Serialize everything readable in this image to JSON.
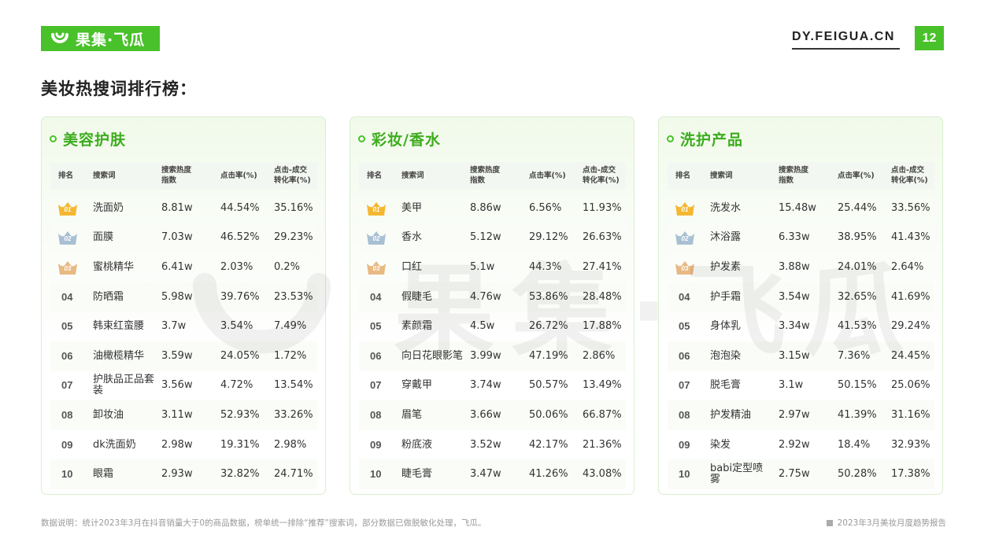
{
  "header": {
    "logo_text": "果集·飞瓜",
    "site": "DY.FEIGUA.CN",
    "page_number": "12",
    "brand_color": "#49c12a"
  },
  "title": "美妆热搜词排行榜：",
  "watermark": "果集·飞瓜",
  "columns": {
    "rank": "排名",
    "keyword": "搜索词",
    "heat_1": "搜索热度",
    "heat_2": "指数",
    "ctr": "点击率(%)",
    "conv_1": "点击-成交",
    "conv_2": "转化率(%)"
  },
  "cards": [
    {
      "title": "美容护肤",
      "rows": [
        {
          "rank": "01",
          "keyword": "洗面奶",
          "heat": "8.81w",
          "ctr": "44.54%",
          "conv": "35.16%"
        },
        {
          "rank": "02",
          "keyword": "面膜",
          "heat": "7.03w",
          "ctr": "46.52%",
          "conv": "29.23%"
        },
        {
          "rank": "03",
          "keyword": "蜜桃精华",
          "heat": "6.41w",
          "ctr": "2.03%",
          "conv": "0.2%"
        },
        {
          "rank": "04",
          "keyword": "防晒霜",
          "heat": "5.98w",
          "ctr": "39.76%",
          "conv": "23.53%"
        },
        {
          "rank": "05",
          "keyword": "韩束红蛮腰",
          "heat": "3.7w",
          "ctr": "3.54%",
          "conv": "7.49%"
        },
        {
          "rank": "06",
          "keyword": "油橄榄精华",
          "heat": "3.59w",
          "ctr": "24.05%",
          "conv": "1.72%"
        },
        {
          "rank": "07",
          "keyword": "护肤品正品套装",
          "heat": "3.56w",
          "ctr": "4.72%",
          "conv": "13.54%"
        },
        {
          "rank": "08",
          "keyword": "卸妆油",
          "heat": "3.11w",
          "ctr": "52.93%",
          "conv": "33.26%"
        },
        {
          "rank": "09",
          "keyword": "dk洗面奶",
          "heat": "2.98w",
          "ctr": "19.31%",
          "conv": "2.98%"
        },
        {
          "rank": "10",
          "keyword": "眼霜",
          "heat": "2.93w",
          "ctr": "32.82%",
          "conv": "24.71%"
        }
      ]
    },
    {
      "title": "彩妆/香水",
      "rows": [
        {
          "rank": "01",
          "keyword": "美甲",
          "heat": "8.86w",
          "ctr": "6.56%",
          "conv": "11.93%"
        },
        {
          "rank": "02",
          "keyword": "香水",
          "heat": "5.12w",
          "ctr": "29.12%",
          "conv": "26.63%"
        },
        {
          "rank": "03",
          "keyword": "口红",
          "heat": "5.1w",
          "ctr": "44.3%",
          "conv": "27.41%"
        },
        {
          "rank": "04",
          "keyword": "假睫毛",
          "heat": "4.76w",
          "ctr": "53.86%",
          "conv": "28.48%"
        },
        {
          "rank": "05",
          "keyword": "素颜霜",
          "heat": "4.5w",
          "ctr": "26.72%",
          "conv": "17.88%"
        },
        {
          "rank": "06",
          "keyword": "向日花眼影笔",
          "heat": "3.99w",
          "ctr": "47.19%",
          "conv": "2.86%"
        },
        {
          "rank": "07",
          "keyword": "穿戴甲",
          "heat": "3.74w",
          "ctr": "50.57%",
          "conv": "13.49%"
        },
        {
          "rank": "08",
          "keyword": "眉笔",
          "heat": "3.66w",
          "ctr": "50.06%",
          "conv": "66.87%"
        },
        {
          "rank": "09",
          "keyword": "粉底液",
          "heat": "3.52w",
          "ctr": "42.17%",
          "conv": "21.36%"
        },
        {
          "rank": "10",
          "keyword": "睫毛膏",
          "heat": "3.47w",
          "ctr": "41.26%",
          "conv": "43.08%"
        }
      ]
    },
    {
      "title": "洗护产品",
      "rows": [
        {
          "rank": "01",
          "keyword": "洗发水",
          "heat": "15.48w",
          "ctr": "25.44%",
          "conv": "33.56%"
        },
        {
          "rank": "02",
          "keyword": "沐浴露",
          "heat": "6.33w",
          "ctr": "38.95%",
          "conv": "41.43%"
        },
        {
          "rank": "03",
          "keyword": "护发素",
          "heat": "3.88w",
          "ctr": "24.01%",
          "conv": "2.64%"
        },
        {
          "rank": "04",
          "keyword": "护手霜",
          "heat": "3.54w",
          "ctr": "32.65%",
          "conv": "41.69%"
        },
        {
          "rank": "05",
          "keyword": "身体乳",
          "heat": "3.34w",
          "ctr": "41.53%",
          "conv": "29.24%"
        },
        {
          "rank": "06",
          "keyword": "泡泡染",
          "heat": "3.15w",
          "ctr": "7.36%",
          "conv": "24.45%"
        },
        {
          "rank": "07",
          "keyword": "脱毛膏",
          "heat": "3.1w",
          "ctr": "50.15%",
          "conv": "25.06%"
        },
        {
          "rank": "08",
          "keyword": "护发精油",
          "heat": "2.97w",
          "ctr": "41.39%",
          "conv": "31.16%"
        },
        {
          "rank": "09",
          "keyword": "染发",
          "heat": "2.92w",
          "ctr": "18.4%",
          "conv": "32.93%"
        },
        {
          "rank": "10",
          "keyword": "babi定型喷雾",
          "heat": "2.75w",
          "ctr": "50.28%",
          "conv": "17.38%"
        }
      ]
    }
  ],
  "medal_colors": [
    "#f5b731",
    "#a9c0d3",
    "#e9b883"
  ],
  "footer": {
    "note": "数据说明：统计2023年3月在抖音销量大于0的商品数据，榜单统一排除“推荐”搜索词，部分数据已做脱敏化处理，飞瓜。",
    "report": "2023年3月美妆月度趋势报告"
  }
}
